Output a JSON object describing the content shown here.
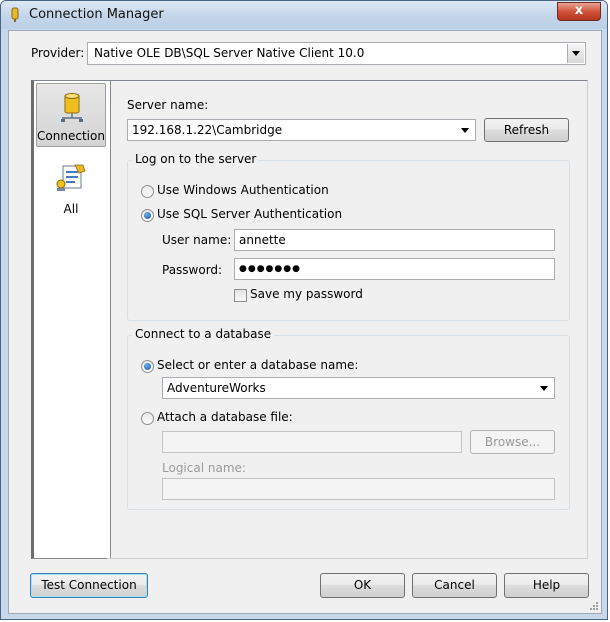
{
  "window": {
    "title": "Connection Manager",
    "close_glyph": "x"
  },
  "provider": {
    "label": "Provider:",
    "value": "Native OLE DB\\SQL Server Native Client 10.0"
  },
  "nav": {
    "items": [
      {
        "label": "Connection",
        "icon": "database-icon",
        "selected": true
      },
      {
        "label": "All",
        "icon": "properties-icon",
        "selected": false
      }
    ]
  },
  "server": {
    "label": "Server name:",
    "value": "192.168.1.22\\Cambridge",
    "refresh_label": "Refresh"
  },
  "logon": {
    "title": "Log on to the server",
    "windows_auth_label": "Use Windows Authentication",
    "sql_auth_label": "Use SQL Server Authentication",
    "selected": "sql",
    "username_label": "User name:",
    "username_value": "annette",
    "password_label": "Password:",
    "password_mask": "●●●●●●●",
    "save_password_label": "Save my password",
    "save_password_checked": false
  },
  "database": {
    "title": "Connect to a database",
    "select_label": "Select or enter a database name:",
    "selected_db": "AdventureWorks",
    "attach_label": "Attach a database file:",
    "attach_value": "",
    "browse_label": "Browse...",
    "logical_name_label": "Logical name:",
    "logical_name_value": "",
    "selected": "select"
  },
  "footer": {
    "test_connection_label": "Test Connection",
    "ok_label": "OK",
    "cancel_label": "Cancel",
    "help_label": "Help"
  },
  "colors": {
    "accent": "#3c7fb1",
    "titlebar": "#c3d5e9",
    "close_button": "#d0533c"
  }
}
